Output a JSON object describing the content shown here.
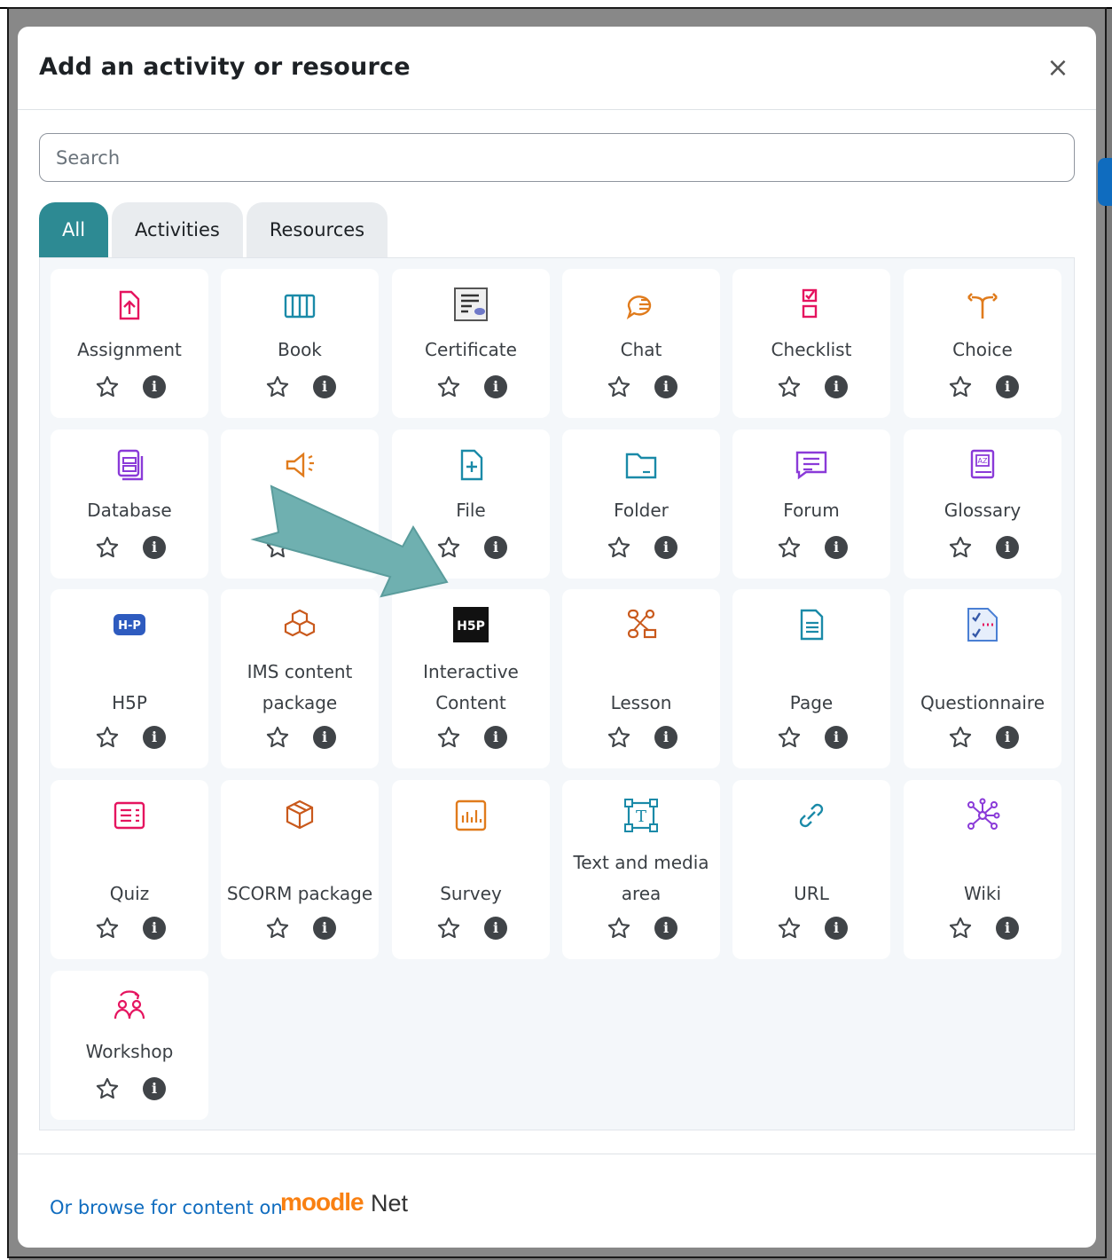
{
  "modal": {
    "title": "Add an activity or resource",
    "close_glyph": "×"
  },
  "search": {
    "placeholder": "Search"
  },
  "tabs": [
    "All",
    "Activities",
    "Resources"
  ],
  "active_tab": "All",
  "items": [
    {
      "name": "Assignment",
      "icon": "assignment-icon",
      "color": "#e5145f"
    },
    {
      "name": "Book",
      "icon": "book-icon",
      "color": "#1a8aa8"
    },
    {
      "name": "Certificate",
      "icon": "certificate-icon",
      "color": "#444444"
    },
    {
      "name": "Chat",
      "icon": "chat-icon",
      "color": "#e07b1c"
    },
    {
      "name": "Checklist",
      "icon": "checklist-icon",
      "color": "#e5145f"
    },
    {
      "name": "Choice",
      "icon": "choice-icon",
      "color": "#e07b1c"
    },
    {
      "name": "Database",
      "icon": "database-icon",
      "color": "#8a3ad8"
    },
    {
      "name": "",
      "icon": "feedback-icon",
      "color": "#e07b1c"
    },
    {
      "name": "File",
      "icon": "file-icon",
      "color": "#1a8aa8"
    },
    {
      "name": "Folder",
      "icon": "folder-icon",
      "color": "#1a8aa8"
    },
    {
      "name": "Forum",
      "icon": "forum-icon",
      "color": "#8a3ad8"
    },
    {
      "name": "Glossary",
      "icon": "glossary-icon",
      "color": "#8a3ad8"
    },
    {
      "name": "H5P",
      "icon": "h5p-icon",
      "color": "#2e5bbf"
    },
    {
      "name": "IMS content package",
      "line1": "IMS content",
      "line2": "package",
      "icon": "ims-package-icon",
      "color": "#c9591c"
    },
    {
      "name": "Interactive Content",
      "line1": "Interactive",
      "line2": "Content",
      "icon": "h5p-dark-icon",
      "color": "#111111"
    },
    {
      "name": "Lesson",
      "icon": "lesson-icon",
      "color": "#c9591c"
    },
    {
      "name": "Page",
      "icon": "page-icon",
      "color": "#1a8aa8"
    },
    {
      "name": "Questionnaire",
      "icon": "questionnaire-icon",
      "color": "#4a7fd4"
    },
    {
      "name": "Quiz",
      "icon": "quiz-icon",
      "color": "#e5145f"
    },
    {
      "name": "SCORM package",
      "icon": "scorm-icon",
      "color": "#c9591c"
    },
    {
      "name": "Survey",
      "icon": "survey-icon",
      "color": "#e07b1c"
    },
    {
      "name": "Text and media area",
      "line1": "Text and media",
      "line2": "area",
      "icon": "text-media-icon",
      "color": "#1a8aa8"
    },
    {
      "name": "URL",
      "icon": "url-icon",
      "color": "#1a8aa8"
    },
    {
      "name": "Wiki",
      "icon": "wiki-icon",
      "color": "#8a3ad8"
    },
    {
      "name": "Workshop",
      "icon": "workshop-icon",
      "color": "#e5145f"
    }
  ],
  "info_glyph": "i",
  "footer": {
    "link_text": "Or browse for content on",
    "logo_text": "moodle",
    "logo_suffix": "Net"
  },
  "colors": {
    "accent_tab": "#2d8a93",
    "link": "#0f6cbf",
    "arrow": "#6fb0b0"
  }
}
